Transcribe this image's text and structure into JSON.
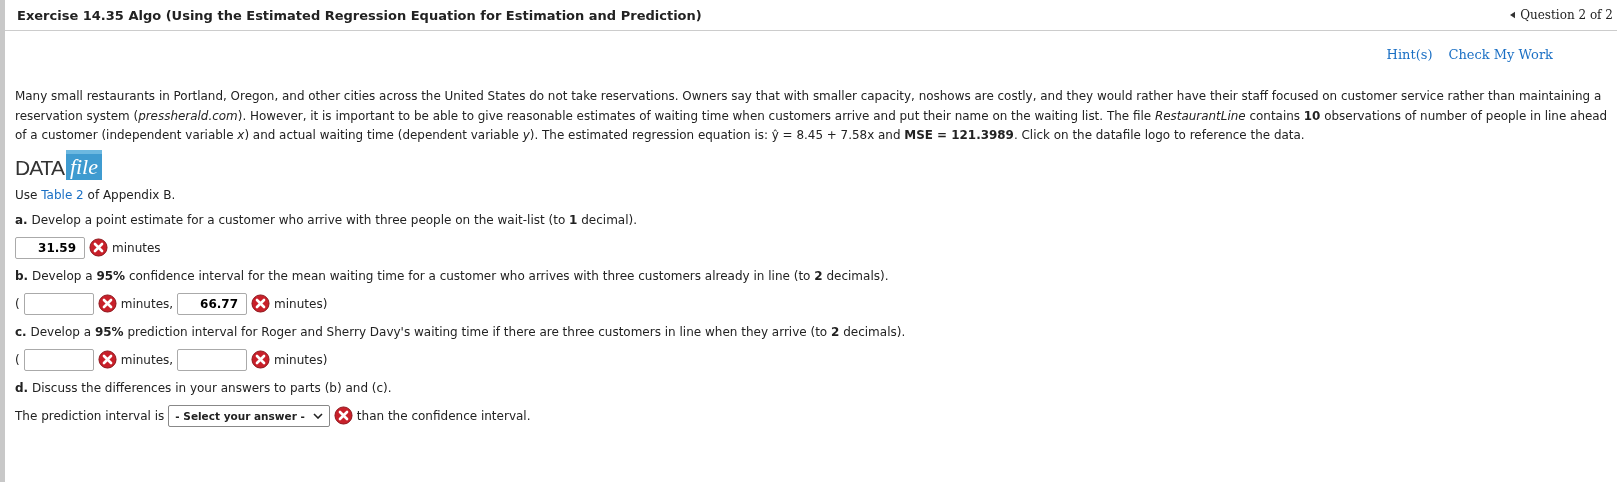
{
  "header": {
    "title": "Exercise 14.35 Algo (Using the Estimated Regression Equation for Estimation and Prediction)",
    "question_nav": "Question 2 of 2"
  },
  "links": [
    "Hint(s)",
    "Check My Work"
  ],
  "intro": "Many small restaurants in Portland, Oregon, and other cities across the United States do not take reservations. Owners say that with smaller capacity, noshows are costly, and they would rather have their staff focused on customer service rather than maintaining a reservation system (*pressherald.com*). However, it is important to be able to give reasonable estimates of waiting time when customers arrive and put their name on the waiting list. The file *RestaurantLine* contains **10** observations of number of people in line ahead of a customer (independent variable *x*) and actual waiting time (dependent variable *y*). The estimated regression equation is: ŷ = 8.45 + 7.58x and **MSE = 121.3989**. Click on the datafile logo to reference the data.",
  "datafile_logo": {
    "word": "DATA",
    "file": "file"
  },
  "table_note": {
    "before": "Use",
    "link": "Table 2",
    "after": "of Appendix B."
  },
  "parts": [
    {
      "label": "a.",
      "prompt": "Develop a point estimate for a customer who arrive with three people on the wait-list (to **1** decimal).",
      "answer": [
        {
          "kind": "field",
          "value": "31.59",
          "correct": false
        },
        {
          "kind": "text",
          "text": "minutes"
        }
      ]
    },
    {
      "label": "b.",
      "prompt": "Develop a **95%** confidence interval for the mean waiting time for a customer who arrives with three customers already in line (to **2** decimals).",
      "answer": [
        {
          "kind": "text",
          "text": "("
        },
        {
          "kind": "field",
          "correct": false
        },
        {
          "kind": "text",
          "text": "minutes,"
        },
        {
          "kind": "field",
          "value": "66.77",
          "correct": false
        },
        {
          "kind": "text",
          "text": "minutes)"
        }
      ]
    },
    {
      "label": "c.",
      "prompt": "Develop a **95%** prediction interval for Roger and Sherry Davy's waiting time if there are three customers in line when they arrive (to **2** decimals).",
      "answer": [
        {
          "kind": "text",
          "text": "("
        },
        {
          "kind": "field",
          "correct": false
        },
        {
          "kind": "text",
          "text": "minutes,"
        },
        {
          "kind": "field",
          "correct": false
        },
        {
          "kind": "text",
          "text": "minutes)"
        }
      ]
    },
    {
      "label": "d.",
      "prompt": "Discuss the differences in your answers to parts (b) and (c)."
    }
  ],
  "final_answer": [
    {
      "kind": "text",
      "text": "The prediction interval is"
    },
    {
      "kind": "select",
      "value": "- Select your answer -",
      "correct": false
    },
    {
      "kind": "text",
      "text": "than the confidence interval."
    }
  ]
}
